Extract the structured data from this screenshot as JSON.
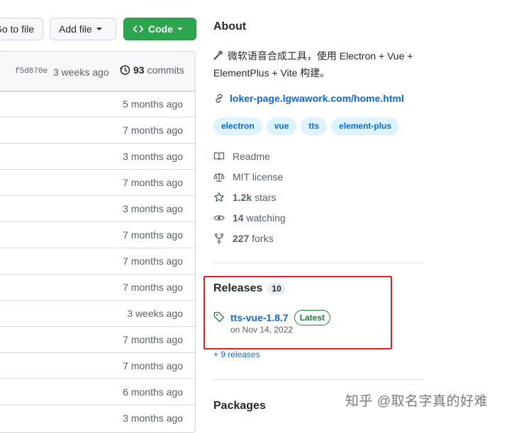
{
  "toolbar": {
    "goto_label": "Go to file",
    "addfile_label": "Add file",
    "code_label": "Code"
  },
  "file_list": {
    "header": {
      "sha": "f5d870e",
      "time": "3 weeks ago",
      "commits_count": "93",
      "commits_label": "commits"
    },
    "rows": [
      {
        "time": "5 months ago"
      },
      {
        "time": "7 months ago"
      },
      {
        "time": "3 months ago"
      },
      {
        "time": "7 months ago"
      },
      {
        "time": "3 months ago"
      },
      {
        "time": "7 months ago"
      },
      {
        "time": "7 months ago"
      },
      {
        "time": "7 months ago"
      },
      {
        "time": "3 weeks ago"
      },
      {
        "time": "7 months ago"
      },
      {
        "time": "7 months ago"
      },
      {
        "time": "6 months ago"
      },
      {
        "time": "3 months ago"
      }
    ]
  },
  "about": {
    "title": "About",
    "description": "微软语音合成工具，使用 Electron + Vue + ElementPlus + Vite 构建。",
    "link": "loker-page.lgwawork.com/home.html",
    "topics": [
      "electron",
      "vue",
      "tts",
      "element-plus"
    ],
    "readme": "Readme",
    "license": "MIT license",
    "stars_count": "1.2k",
    "stars_label": "stars",
    "watching_count": "14",
    "watching_label": "watching",
    "forks_count": "227",
    "forks_label": "forks"
  },
  "releases": {
    "title": "Releases",
    "count": "10",
    "latest_name": "tts-vue-1.8.7",
    "latest_badge": "Latest",
    "latest_date": "on Nov 14, 2022",
    "more": "+ 9 releases"
  },
  "packages": {
    "title": "Packages"
  },
  "watermark": "知乎 @取名字真的好难",
  "colors": {
    "accent": "#0969da",
    "code_button": "#2da44e",
    "latest_badge": "#1a7f37",
    "highlight_box": "#d42626"
  }
}
